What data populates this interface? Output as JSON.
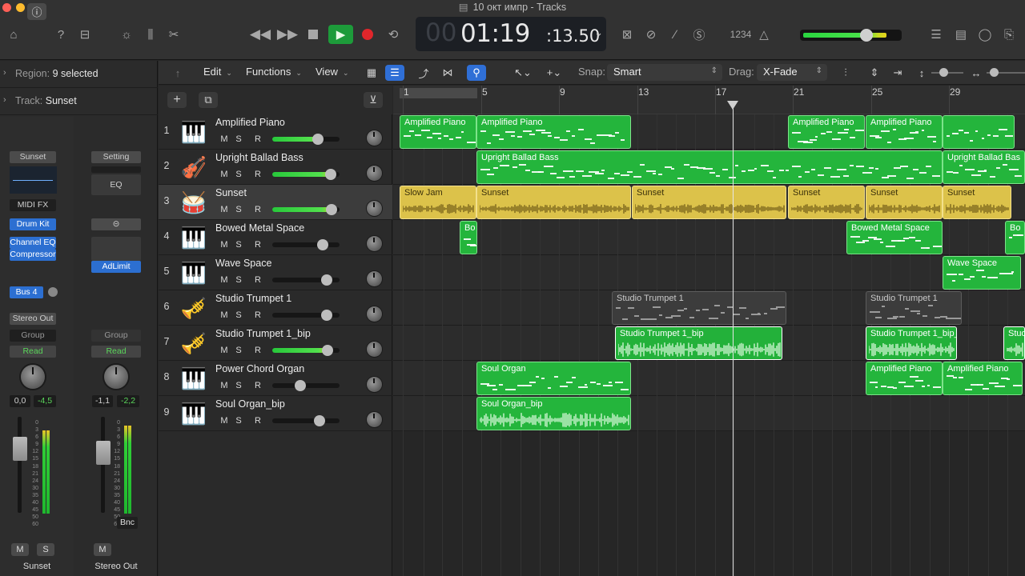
{
  "window": {
    "title": "10 окт импр - Tracks"
  },
  "transport": {
    "lcd_bars": "00",
    "lcd_time": "01:19",
    "lcd_sub": ":13.50",
    "count_in": "1234"
  },
  "inspector": {
    "region_label": "Region:",
    "region_value": "9 selected",
    "track_label": "Track:",
    "track_value": "Sunset",
    "strip1": {
      "name_btn": "Sunset",
      "midi_fx": "MIDI FX",
      "instrument": "Drum Kit",
      "fx1": "Channel EQ",
      "fx2": "Compressor",
      "send": "Bus 4",
      "output": "Stereo Out",
      "group": "Group",
      "auto": "Read",
      "vol": "0,0",
      "peak": "-4,5",
      "m": "M",
      "s": "S",
      "name": "Sunset"
    },
    "strip2": {
      "name_btn": "Setting",
      "eq": "EQ",
      "fx1": "AdLimit",
      "group": "Group",
      "auto": "Read",
      "vol": "-1,1",
      "peak": "-2,2",
      "bnc": "Bnc",
      "m": "M",
      "name": "Stereo Out"
    },
    "scale": [
      "0",
      "3",
      "6",
      "9",
      "12",
      "15",
      "18",
      "21",
      "24",
      "30",
      "35",
      "40",
      "45",
      "50",
      "60"
    ]
  },
  "toolbar": {
    "edit": "Edit",
    "functions": "Functions",
    "view": "View",
    "snap_label": "Snap:",
    "snap_value": "Smart",
    "drag_label": "Drag:",
    "drag_value": "X-Fade"
  },
  "ruler": [
    "1",
    "5",
    "9",
    "13",
    "17",
    "21",
    "25",
    "29"
  ],
  "tracks": [
    {
      "num": "1",
      "name": "Amplified Piano",
      "icon": "🎹",
      "vol": 0.72
    },
    {
      "num": "2",
      "name": "Upright Ballad Bass",
      "icon": "🎻",
      "vol": 0.9
    },
    {
      "num": "3",
      "name": "Sunset",
      "icon": "🥁",
      "vol": 0.92
    },
    {
      "num": "4",
      "name": "Bowed Metal Space",
      "icon": "🎹",
      "vol": 0.78
    },
    {
      "num": "5",
      "name": "Wave Space",
      "icon": "🎹",
      "vol": 0.84
    },
    {
      "num": "6",
      "name": "Studio Trumpet 1",
      "icon": "🎺",
      "vol": 0.84
    },
    {
      "num": "7",
      "name": "Studio Trumpet 1_bip",
      "icon": "🎺",
      "vol": 0.86
    },
    {
      "num": "8",
      "name": "Power Chord Organ",
      "icon": "🎹",
      "vol": 0.45
    },
    {
      "num": "9",
      "name": "Soul Organ_bip",
      "icon": "🎹",
      "vol": 0.74
    }
  ],
  "track_buttons": {
    "m": "M",
    "s": "S",
    "r": "R"
  },
  "regions": {
    "r1a": "Amplified Piano",
    "r1b": "Amplified Piano",
    "r1c": "Amplified Piano",
    "r1d": "Amplified Piano",
    "r2a": "Upright Ballad Bass",
    "r2b": "Upright Ballad Bas",
    "r3a": "Slow Jam",
    "r3b": "Sunset",
    "r3c": "Sunset",
    "r3d": "Sunset",
    "r3e": "Sunset",
    "r3f": "Sunset",
    "r4a": "Bo",
    "r4b": "Bowed Metal Space",
    "r4c": "Bo",
    "r5a": "Wave Space",
    "r6a": "Studio Trumpet 1",
    "r6b": "Studio Trumpet 1",
    "r7a": "Studio Trumpet 1_bip",
    "r7b": "Studio Trumpet 1_bip_",
    "r7c": "Stud",
    "r8a": "Soul Organ",
    "r8b": "Amplified Piano",
    "r8c": "Amplified Piano",
    "r9a": "Soul Organ_bip"
  },
  "colors": {
    "region_green": "#24b53c",
    "region_yellow": "#dcc24a",
    "accent_blue": "#2f6fd6",
    "record": "#e0262b"
  }
}
